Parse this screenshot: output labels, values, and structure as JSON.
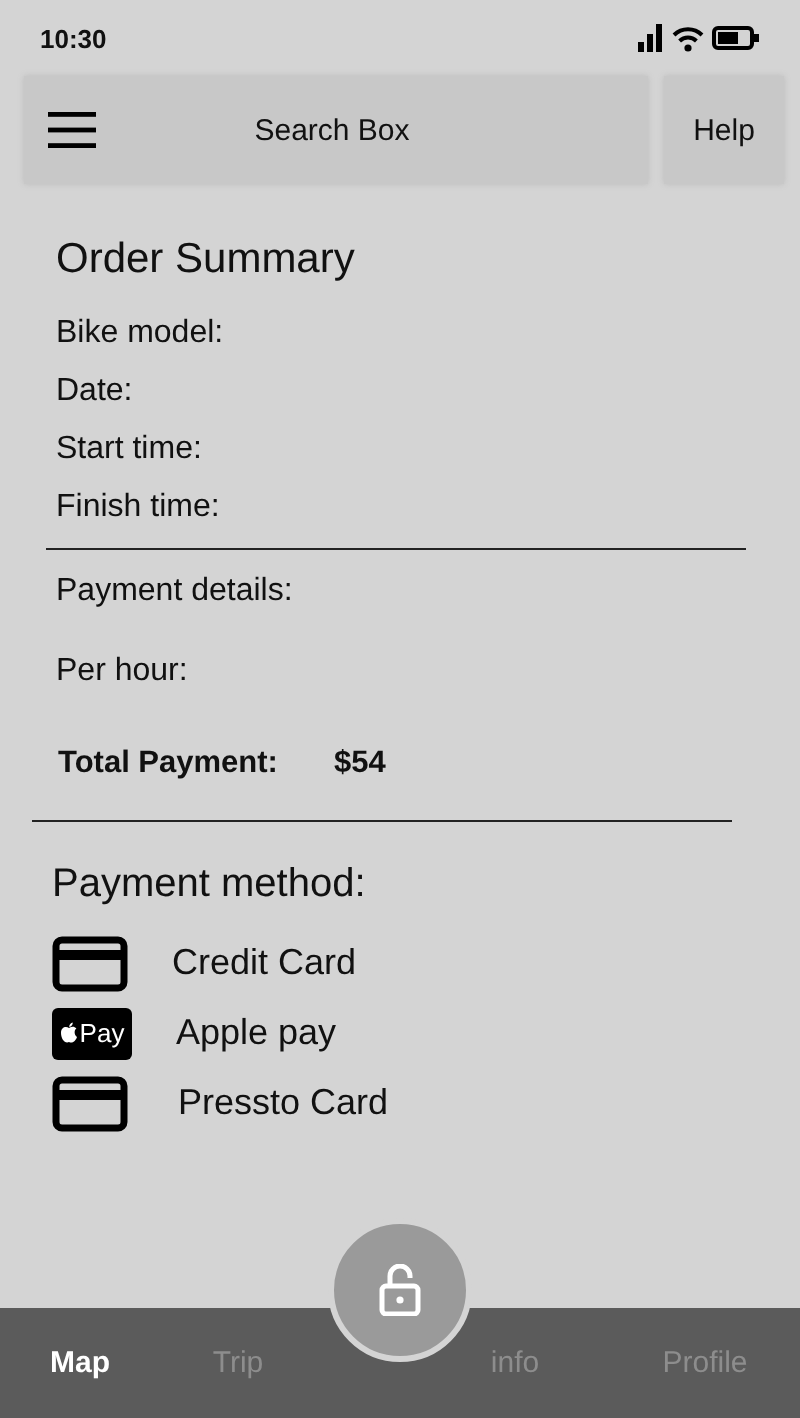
{
  "status_bar": {
    "time": "10:30"
  },
  "top_bar": {
    "search": {
      "placeholder": "Search Box"
    },
    "help_button": "Help"
  },
  "order_summary": {
    "title": "Order Summary",
    "fields": [
      "Bike model:",
      "Date:",
      "Start time:",
      "Finish time:"
    ],
    "payment_details": "Payment details:",
    "per_hour": "Per hour:",
    "total": {
      "label": "Total Payment:",
      "value": "$54"
    }
  },
  "payment_method": {
    "title": "Payment method:",
    "methods": [
      {
        "kind": "card",
        "label": "Credit Card"
      },
      {
        "kind": "applepay",
        "icon_text": "Pay",
        "label": "Apple pay"
      },
      {
        "kind": "card",
        "label": "Pressto Card"
      }
    ]
  },
  "bottom_nav": {
    "tabs": [
      {
        "label": "Map",
        "selected": true
      },
      {
        "label": "Trip",
        "selected": false
      },
      {
        "label": "info",
        "selected": false
      },
      {
        "label": "Profile",
        "selected": false
      }
    ]
  }
}
